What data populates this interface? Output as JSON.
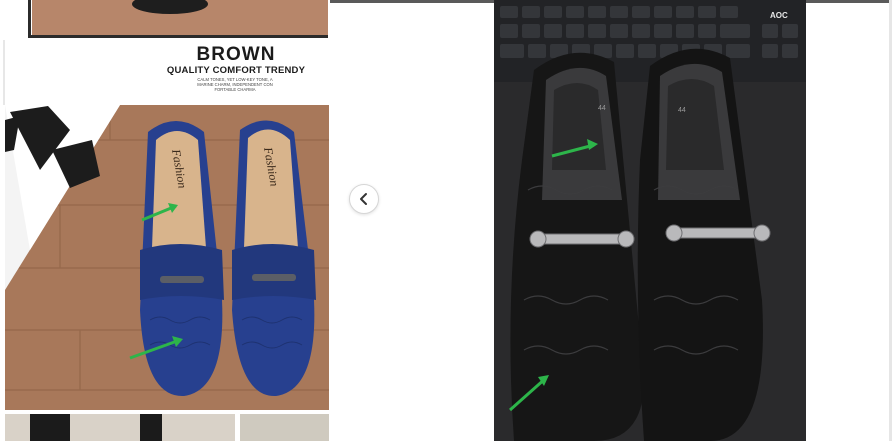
{
  "gallery": {
    "left_image": {
      "heading": "BROWN",
      "tagline": "QUALITY COMFORT TRENDY",
      "copy": "CALM TONES, YET LOW-KEY TONE, A MARINE CHARM, INDEPENDENT CON FORTABLE CHARMA",
      "insole_label": "Fashion",
      "colors": {
        "shoe": "#27408f",
        "wood": "#a8785a",
        "insole": "#d8b48c"
      }
    },
    "right_image": {
      "keyboard_brand": "AOC",
      "size_marking": "44",
      "colors": {
        "shoe": "#161616",
        "keyboard": "#222326"
      }
    },
    "controls": {
      "prev_icon": "chevron-left-icon"
    }
  }
}
